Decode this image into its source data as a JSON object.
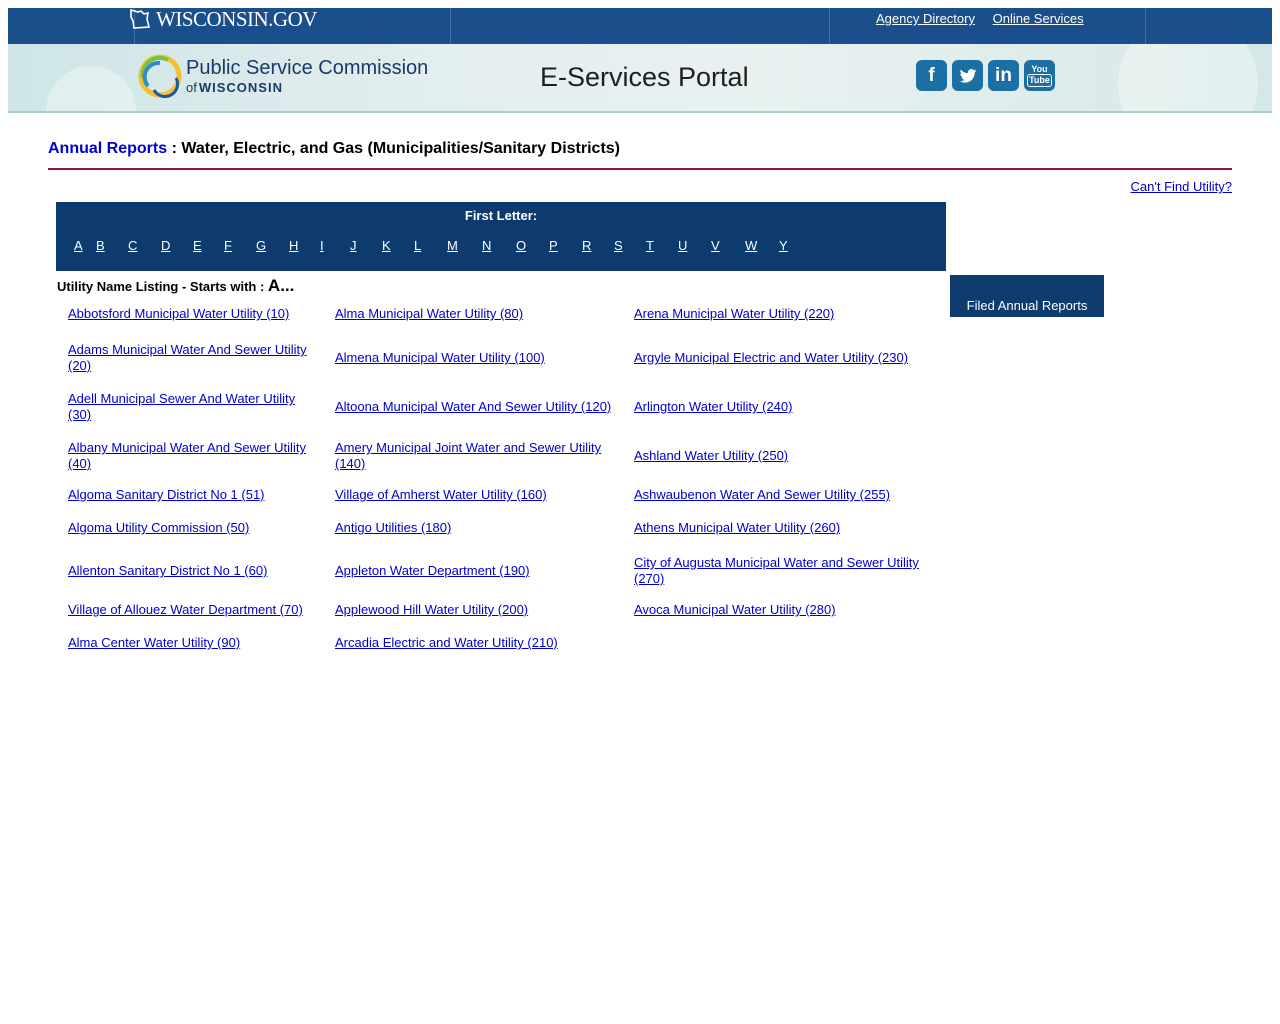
{
  "govbar": {
    "logo_text": "WISCONSIN.GOV",
    "links": [
      "Agency Directory",
      "Online Services"
    ]
  },
  "banner": {
    "org_line1": "Public Service Commission",
    "org_line2_prefix": "of",
    "org_line2": "WISCONSIN",
    "portal_title": "E-Services Portal",
    "social_icons": [
      "facebook-icon",
      "twitter-icon",
      "linkedin-icon",
      "youtube-icon"
    ]
  },
  "page": {
    "heading_link": "Annual Reports",
    "heading_rest": " : Water, Electric, and Gas (Municipalities/Sanitary Districts)",
    "cant_find": "Can't Find Utility?",
    "first_letter_label": "First Letter:",
    "letters": [
      "A",
      "B",
      "C",
      "D",
      "E",
      "F",
      "G",
      "H",
      "I",
      "J",
      "K",
      "L",
      "M",
      "N",
      "O",
      "P",
      "R",
      "S",
      "T",
      "U",
      "V",
      "W",
      "Y"
    ],
    "listing_label": "Utility Name Listing - Starts with : ",
    "listing_letter": "A...",
    "filed_box": "Filed Annual Reports"
  },
  "utilities": {
    "col0": [
      "Abbotsford Municipal Water Utility (10)",
      "Adams Municipal Water And Sewer Utility (20)",
      "Adell Municipal Sewer And Water Utility (30)",
      "Albany Municipal Water And Sewer Utility (40)",
      "Algoma Sanitary District No 1 (51)",
      "Algoma Utility Commission (50)",
      "Allenton Sanitary District No 1 (60)",
      "Village of Allouez Water Department (70)",
      "Alma Center Water Utility (90)"
    ],
    "col1": [
      "Alma Municipal Water Utility (80)",
      "Almena Municipal Water Utility (100)",
      "Altoona Municipal Water And Sewer Utility (120)",
      "Amery Municipal Joint Water and Sewer Utility (140)",
      "Village of Amherst Water Utility (160)",
      "Antigo Utilities (180)",
      "Appleton Water Department (190)",
      "Applewood Hill Water Utility (200)",
      "Arcadia Electric and Water Utility (210)"
    ],
    "col2": [
      "Arena Municipal Water Utility (220)",
      "Argyle Municipal Electric and Water Utility (230)",
      "Arlington Water Utility (240)",
      "Ashland Water Utility (250)",
      "Ashwaubenon Water And Sewer Utility (255)",
      "Athens Municipal Water Utility (260)",
      "City of Augusta Municipal Water and Sewer Utility (270)",
      "Avoca Municipal Water Utility (280)"
    ]
  }
}
